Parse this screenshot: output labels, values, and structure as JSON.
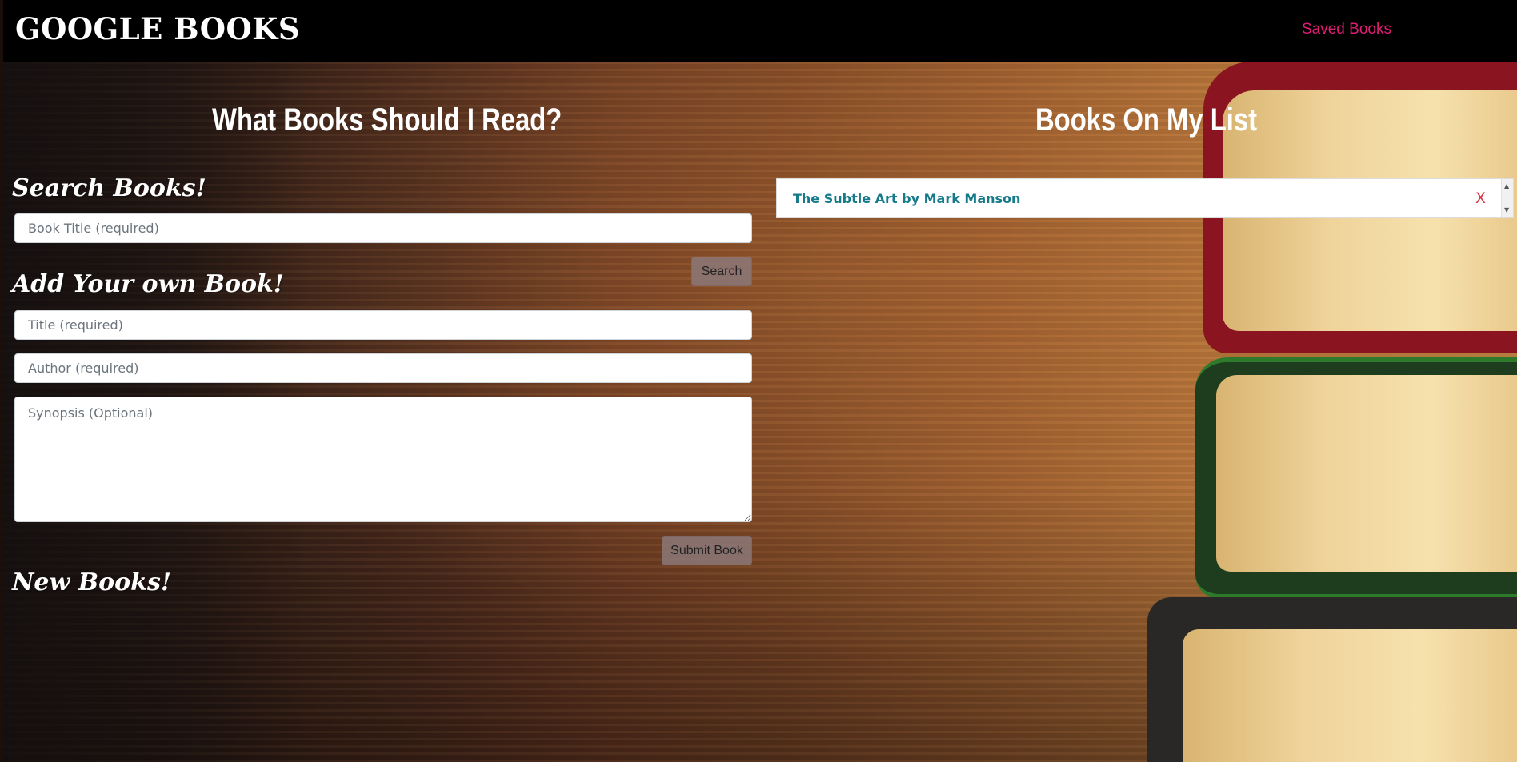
{
  "navbar": {
    "brand": "GOOGLE BOOKS",
    "saved_link": "Saved Books",
    "link_color": "#e01d74"
  },
  "left": {
    "heading": "What Books Should I Read?",
    "search_section": {
      "title": "Search Books!",
      "input_placeholder": "Book Title (required)",
      "input_value": "",
      "button_label": "Search"
    },
    "add_section": {
      "title": "Add Your own Book!",
      "title_placeholder": "Title (required)",
      "author_placeholder": "Author (required)",
      "synopsis_placeholder": "Synopsis (Optional)",
      "button_label": "Submit Book"
    },
    "new_books": {
      "title": "New Books!"
    }
  },
  "right": {
    "heading": "Books On My List",
    "items": [
      {
        "label": "The Subtle Art by Mark Manson",
        "remove_label": "X"
      }
    ]
  },
  "icons": {
    "scroll_up": "scroll-up-arrow",
    "scroll_down": "scroll-down-arrow"
  }
}
